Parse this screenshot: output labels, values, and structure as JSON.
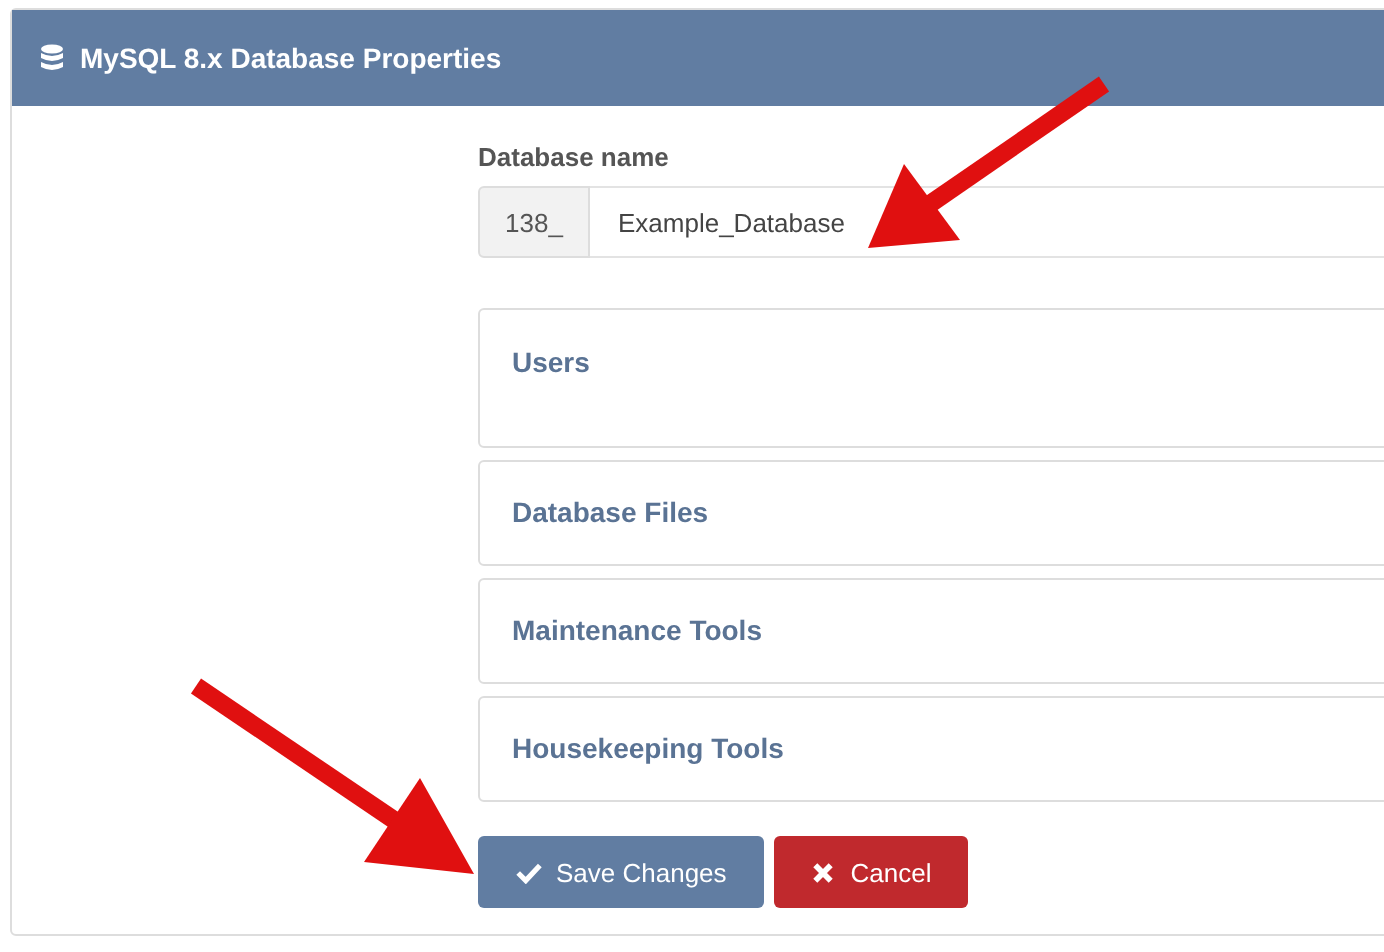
{
  "panel": {
    "title": "MySQL 8.x Database Properties"
  },
  "database_name": {
    "label": "Database name",
    "prefix": "138_",
    "value": "Example_Database"
  },
  "sections": [
    {
      "title": "Users",
      "tall": true
    },
    {
      "title": "Database Files",
      "tall": false
    },
    {
      "title": "Maintenance Tools",
      "tall": false
    },
    {
      "title": "Housekeeping Tools",
      "tall": false
    }
  ],
  "buttons": [
    {
      "label": "Save Changes",
      "kind": "save"
    },
    {
      "label": "Cancel",
      "kind": "cancel"
    }
  ]
}
